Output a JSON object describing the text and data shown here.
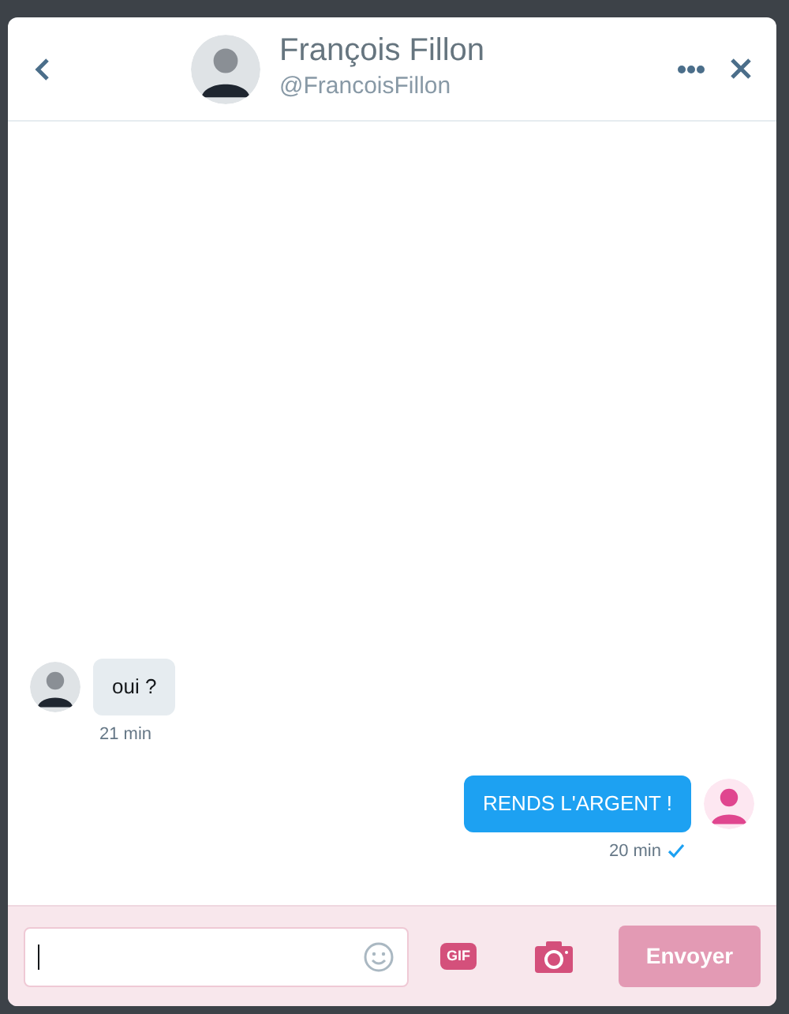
{
  "header": {
    "name": "François Fillon",
    "handle": "@FrancoisFillon"
  },
  "messages": [
    {
      "kind": "received",
      "text": "oui ?",
      "time": "21 min",
      "seen": false
    },
    {
      "kind": "sent",
      "text": "RENDS L'ARGENT !",
      "time": "20 min",
      "seen": true
    }
  ],
  "composer": {
    "gif_label": "GIF",
    "send_label": "Envoyer",
    "send_disabled": true
  }
}
